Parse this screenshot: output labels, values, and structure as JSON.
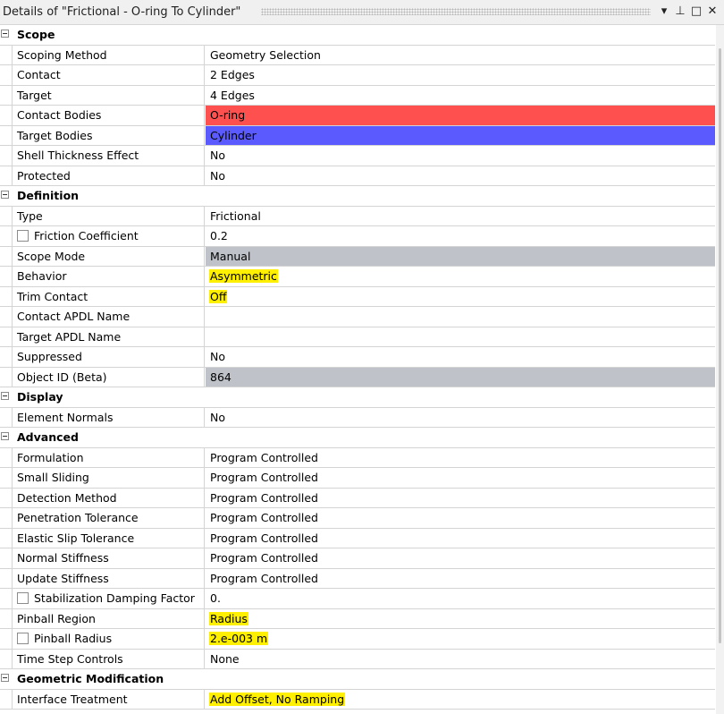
{
  "window": {
    "title": "Details of \"Frictional - O-ring To Cylinder\"",
    "buttons": {
      "dropdown": "▾",
      "pin": "⊥",
      "maximize": "□",
      "close": "✕"
    }
  },
  "colors": {
    "contact_bodies": "#ff5050",
    "target_bodies": "#5a5aff",
    "readonly_gray": "#bfc3c9",
    "highlight": "#ffef00"
  },
  "rows": [
    {
      "kind": "cat",
      "label": "Scope"
    },
    {
      "kind": "prop",
      "name": "Scoping Method",
      "value": "Geometry Selection"
    },
    {
      "kind": "prop",
      "name": "Contact",
      "value": "2 Edges"
    },
    {
      "kind": "prop",
      "name": "Target",
      "value": "4 Edges"
    },
    {
      "kind": "prop",
      "name": "Contact Bodies",
      "value": "O-ring",
      "bg": "#ff5050"
    },
    {
      "kind": "prop",
      "name": "Target Bodies",
      "value": "Cylinder",
      "bg": "#5a5aff"
    },
    {
      "kind": "prop",
      "name": "Shell Thickness Effect",
      "value": "No"
    },
    {
      "kind": "prop",
      "name": "Protected",
      "value": "No"
    },
    {
      "kind": "cat",
      "label": "Definition"
    },
    {
      "kind": "prop",
      "name": "Type",
      "value": "Frictional"
    },
    {
      "kind": "prop",
      "name": "Friction Coefficient",
      "value": "0.2",
      "checkbox": true
    },
    {
      "kind": "prop",
      "name": "Scope Mode",
      "value": "Manual",
      "gray": true
    },
    {
      "kind": "prop",
      "name": "Behavior",
      "value": "Asymmetric",
      "highlight": true
    },
    {
      "kind": "prop",
      "name": "Trim Contact",
      "value": "Off",
      "highlight": true
    },
    {
      "kind": "prop",
      "name": "Contact APDL Name",
      "value": ""
    },
    {
      "kind": "prop",
      "name": "Target APDL Name",
      "value": ""
    },
    {
      "kind": "prop",
      "name": "Suppressed",
      "value": "No"
    },
    {
      "kind": "prop",
      "name": "Object ID (Beta)",
      "value": "864",
      "gray": true
    },
    {
      "kind": "cat",
      "label": "Display"
    },
    {
      "kind": "prop",
      "name": "Element Normals",
      "value": "No"
    },
    {
      "kind": "cat",
      "label": "Advanced"
    },
    {
      "kind": "prop",
      "name": "Formulation",
      "value": "Program Controlled"
    },
    {
      "kind": "prop",
      "name": "Small Sliding",
      "value": "Program Controlled"
    },
    {
      "kind": "prop",
      "name": "Detection Method",
      "value": "Program Controlled"
    },
    {
      "kind": "prop",
      "name": "Penetration Tolerance",
      "value": "Program Controlled"
    },
    {
      "kind": "prop",
      "name": "Elastic Slip Tolerance",
      "value": "Program Controlled"
    },
    {
      "kind": "prop",
      "name": "Normal Stiffness",
      "value": "Program Controlled"
    },
    {
      "kind": "prop",
      "name": "Update Stiffness",
      "value": "Program Controlled"
    },
    {
      "kind": "prop",
      "name": "Stabilization Damping Factor",
      "value": "0.",
      "checkbox": true
    },
    {
      "kind": "prop",
      "name": "Pinball Region",
      "value": "Radius",
      "highlight": true
    },
    {
      "kind": "prop",
      "name": "Pinball Radius",
      "value": "2.e-003 m",
      "checkbox": true,
      "highlight": true
    },
    {
      "kind": "prop",
      "name": "Time Step Controls",
      "value": "None"
    },
    {
      "kind": "cat",
      "label": "Geometric Modification"
    },
    {
      "kind": "prop",
      "name": "Interface Treatment",
      "value": "Add Offset, No Ramping",
      "highlight": true
    }
  ]
}
